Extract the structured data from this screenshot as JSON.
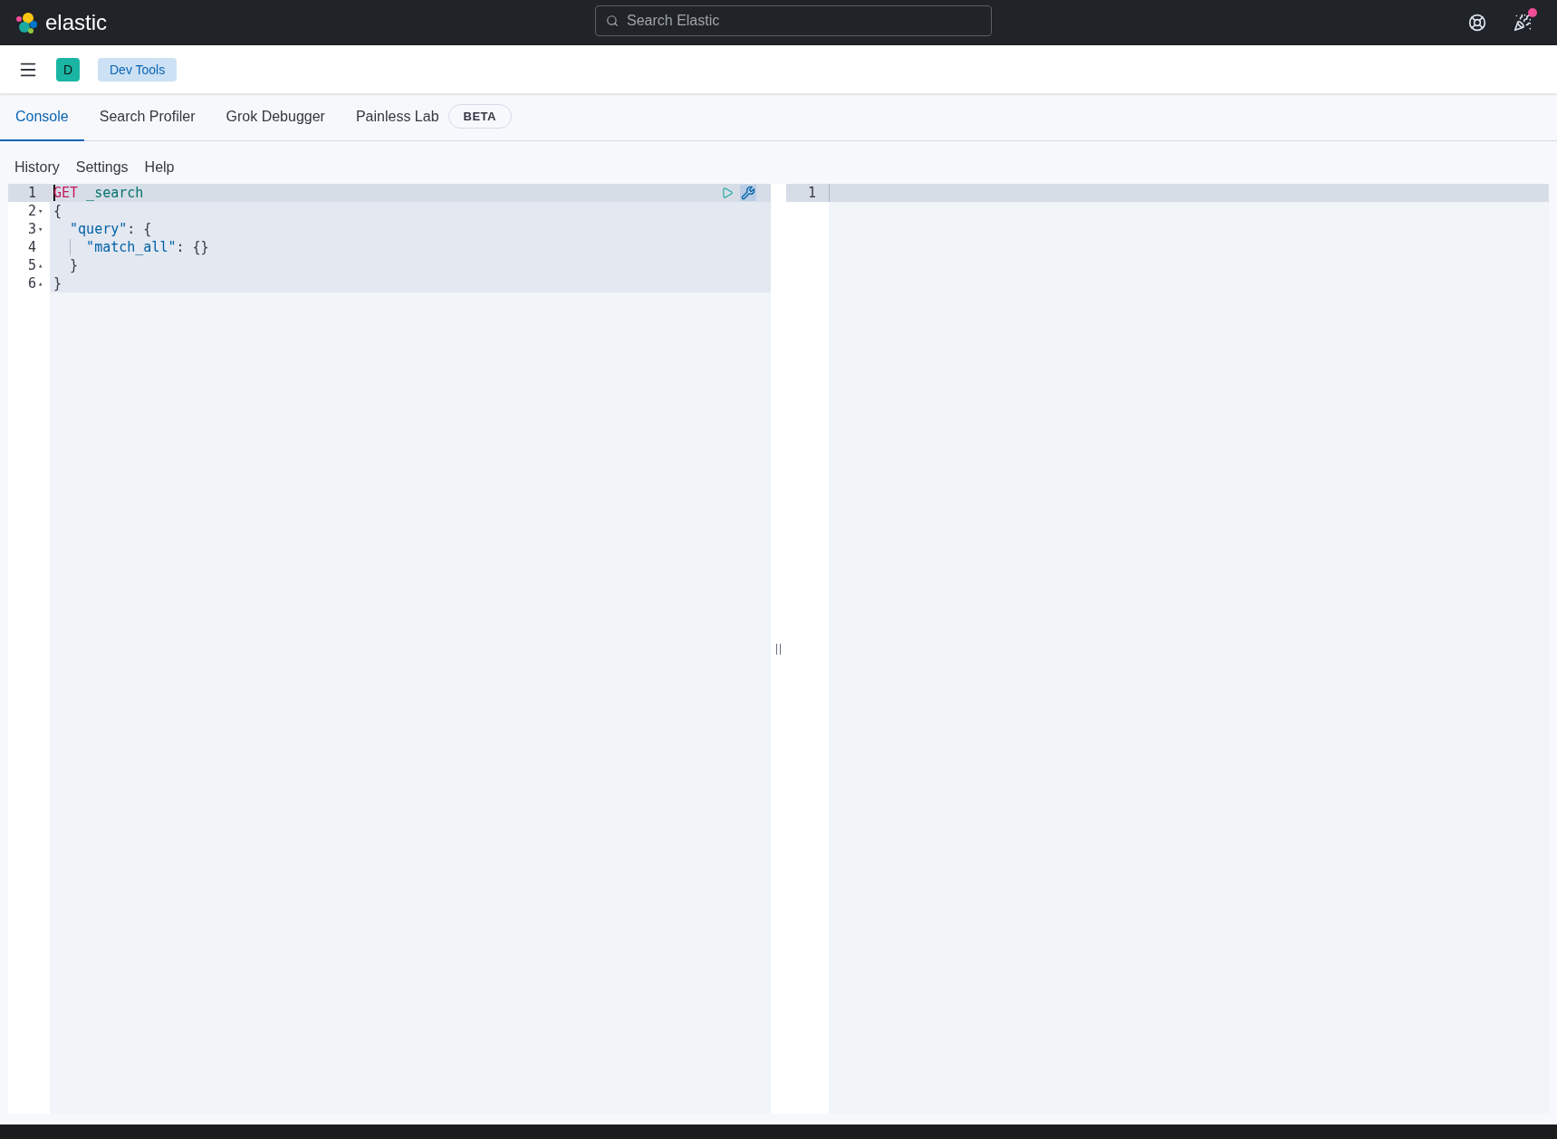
{
  "header": {
    "brand": "elastic",
    "search": {
      "placeholder": "Search Elastic"
    },
    "notification": true
  },
  "breadcrumb": {
    "avatar": "D",
    "crumb": "Dev Tools"
  },
  "tabs": [
    {
      "label": "Console",
      "selected": true
    },
    {
      "label": "Search Profiler",
      "selected": false
    },
    {
      "label": "Grok Debugger",
      "selected": false
    },
    {
      "label": "Painless Lab",
      "selected": false,
      "badge": "BETA"
    }
  ],
  "menu": [
    "History",
    "Settings",
    "Help"
  ],
  "request_editor": {
    "lines": [
      {
        "number": "1",
        "active": true,
        "indent_guide": false,
        "tokens": [
          {
            "kind": "method",
            "text": "GET"
          },
          {
            "kind": "url",
            "text": " _search"
          }
        ]
      },
      {
        "number": "2",
        "fold_marker": "▾",
        "active": false,
        "indent_guide": false,
        "tokens": [
          {
            "kind": "punct",
            "text": "{"
          }
        ]
      },
      {
        "number": "3",
        "fold_marker": "▾",
        "active": false,
        "indent_guide": false,
        "tokens": [
          {
            "kind": "key",
            "text": "  \"query\""
          },
          {
            "kind": "punct",
            "text": ": {"
          }
        ]
      },
      {
        "number": "4",
        "active": false,
        "indent_guide": true,
        "tokens": [
          {
            "kind": "key",
            "text": "    \"match_all\""
          },
          {
            "kind": "punct",
            "text": ": {}"
          }
        ]
      },
      {
        "number": "5",
        "fold_marker": "▴",
        "active": false,
        "indent_guide": false,
        "tokens": [
          {
            "kind": "punct",
            "text": "  }"
          }
        ]
      },
      {
        "number": "6",
        "fold_marker": "▴",
        "active": false,
        "indent_guide": false,
        "tokens": [
          {
            "kind": "punct",
            "text": "}"
          }
        ]
      }
    ]
  },
  "response_editor": {
    "lines": [
      {
        "number": "1",
        "active": true
      }
    ]
  }
}
